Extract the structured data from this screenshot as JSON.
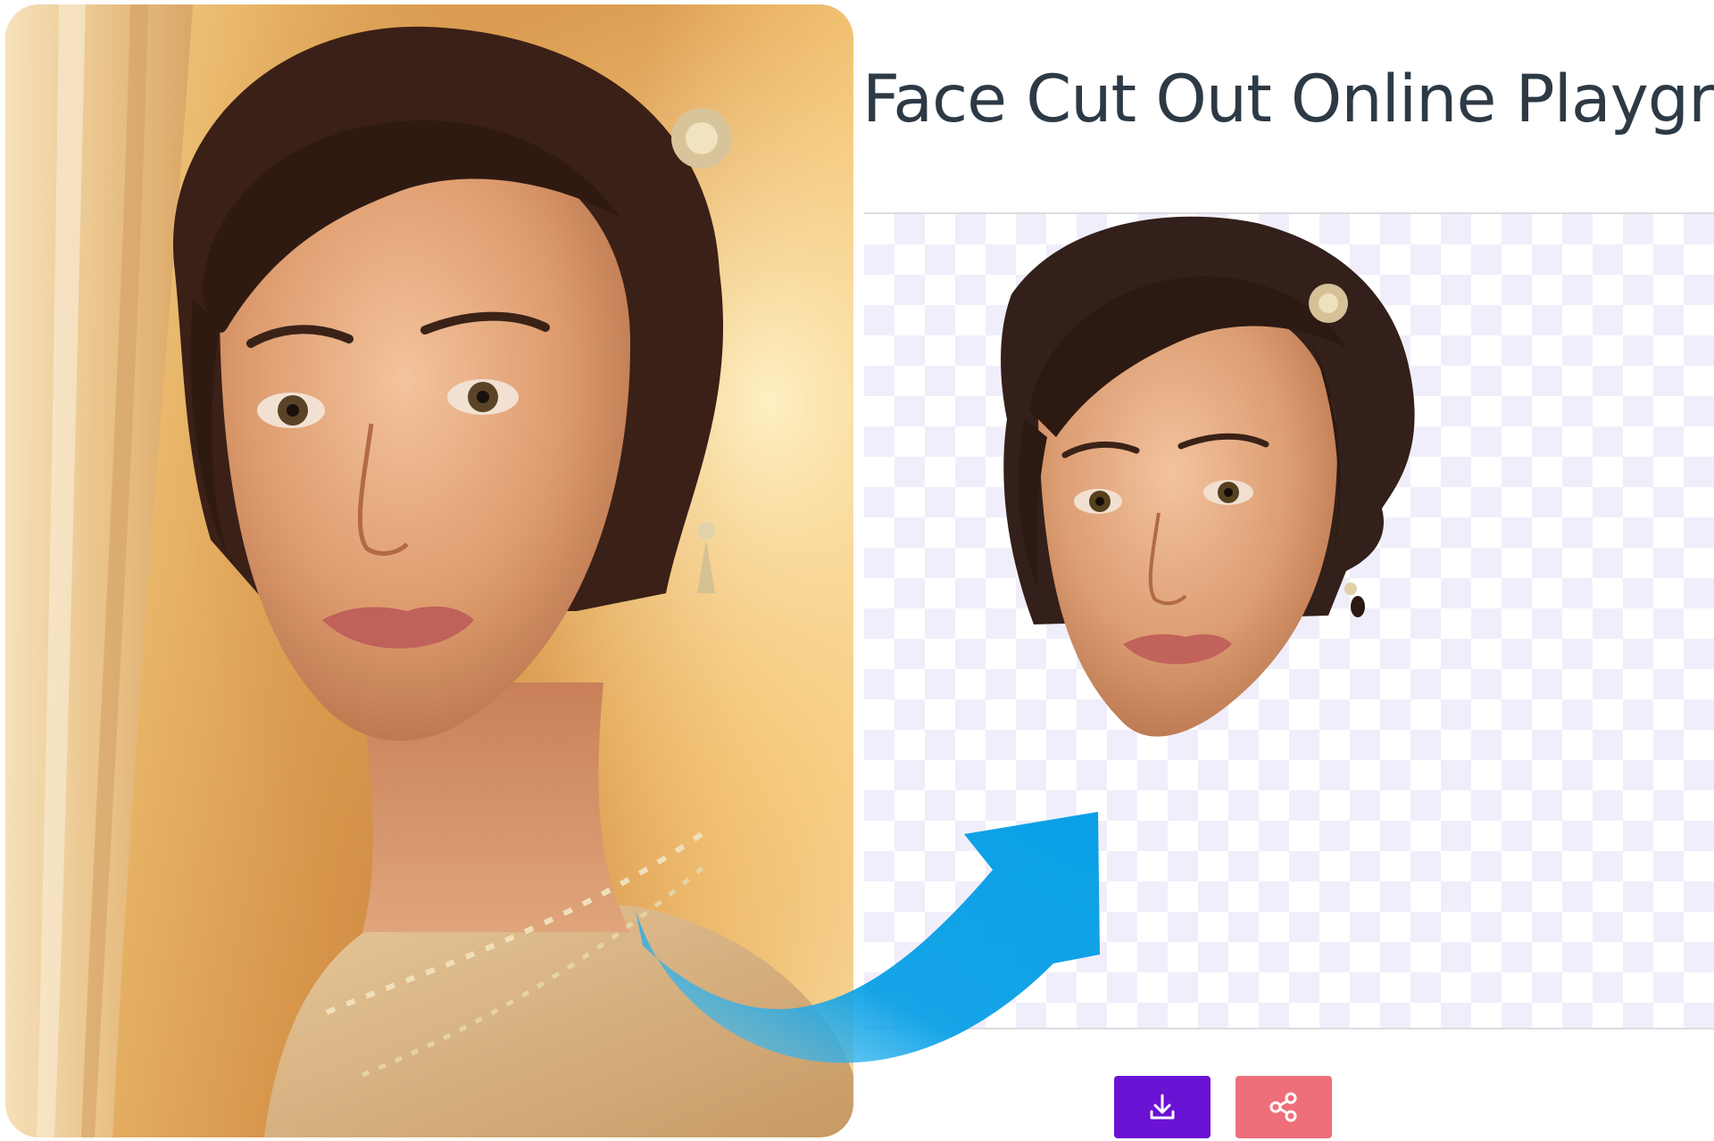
{
  "playground": {
    "title": "Face Cut Out Online Playground"
  },
  "actions": {
    "download_icon": "download-icon",
    "share_icon": "share-icon"
  },
  "colors": {
    "title_text": "#2d3a45",
    "download_button": "#6a12d4",
    "share_button": "#ee6f7a",
    "arrow": "#0aa0e6",
    "checker": "#f1eefb"
  }
}
